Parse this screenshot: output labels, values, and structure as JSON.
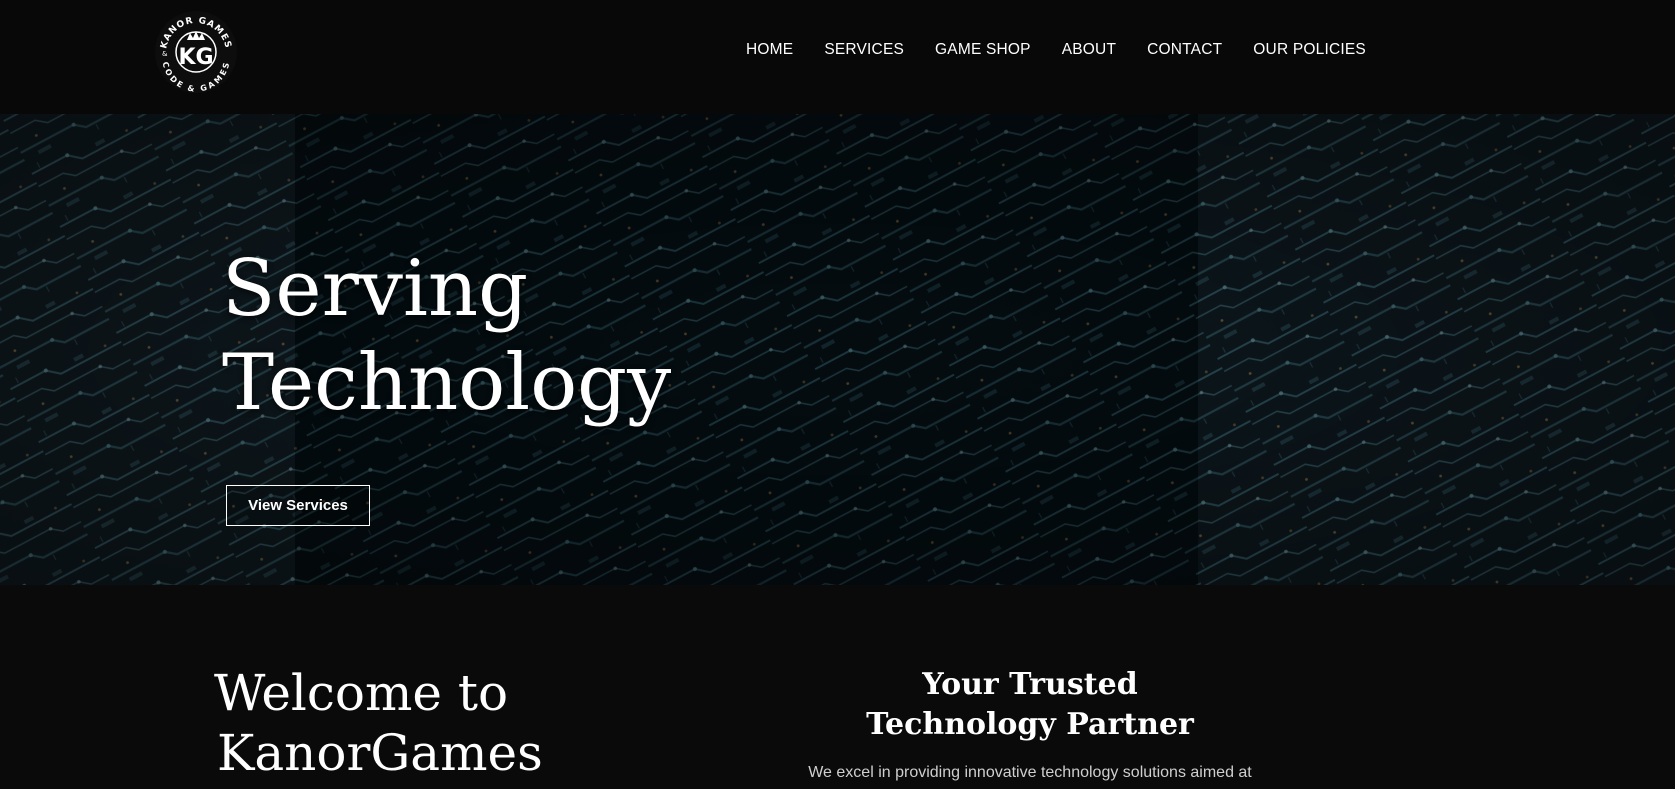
{
  "brand": {
    "logo_ring_text_top": "KANOR GAMES",
    "logo_ring_text_bottom": "CODE & GAMES",
    "logo_monogram": "KG"
  },
  "nav": {
    "items": [
      {
        "label": "HOME"
      },
      {
        "label": "SERVICES"
      },
      {
        "label": "GAME SHOP"
      },
      {
        "label": "ABOUT"
      },
      {
        "label": "CONTACT"
      },
      {
        "label": "OUR POLICIES"
      }
    ]
  },
  "hero": {
    "title_line1": "Serving",
    "title_line2": "Technology",
    "button_label": "View Services"
  },
  "welcome": {
    "line1": "Welcome to",
    "line2": "KanorGames"
  },
  "partner": {
    "title_line1": "Your Trusted",
    "title_line2": "Technology Partner",
    "text": "We excel in providing innovative technology solutions aimed at"
  },
  "colors": {
    "background": "#0a0a0a",
    "header": "#080808",
    "hero_base": "#061117",
    "circuit": "#2e5a66"
  }
}
